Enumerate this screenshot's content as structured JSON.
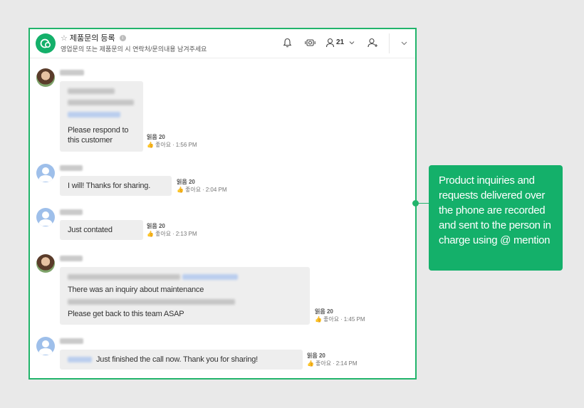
{
  "header": {
    "title": "제품문의 등록",
    "subtitle": "영업문의 또는 제품문의 시 연락처/문의내용 남겨주세요",
    "member_count": "21"
  },
  "messages": [
    {
      "text": "Please respond to this customer",
      "read": "읽음 20",
      "like": "좋아요",
      "time": "1:56 PM",
      "avatar": "photo"
    },
    {
      "text": "I will! Thanks for sharing.",
      "read": "읽음 20",
      "like": "좋아요",
      "time": "2:04 PM",
      "avatar": "blank"
    },
    {
      "text": "Just contated",
      "read": "읽음 20",
      "like": "좋아요",
      "time": "2:13 PM",
      "avatar": "blank"
    },
    {
      "text_line1": "There was an inquiry about maintenance",
      "text_line2": "Please get back to this team ASAP",
      "read": "읽음 20",
      "like": "좋아요",
      "time": "1:45 PM",
      "avatar": "photo"
    },
    {
      "text": "Just finished the call now. Thank you for sharing!",
      "read": "읽음 20",
      "like": "좋아요",
      "time": "2:14 PM",
      "avatar": "blank"
    }
  ],
  "callout": {
    "text": "Product inquiries and requests delivered over the phone are recorded and sent to the person in charge using @ mention"
  },
  "colors": {
    "accent": "#14b06a",
    "frame": "#21b46b",
    "bubble": "#eeeeee",
    "background": "#e9e9e9"
  }
}
